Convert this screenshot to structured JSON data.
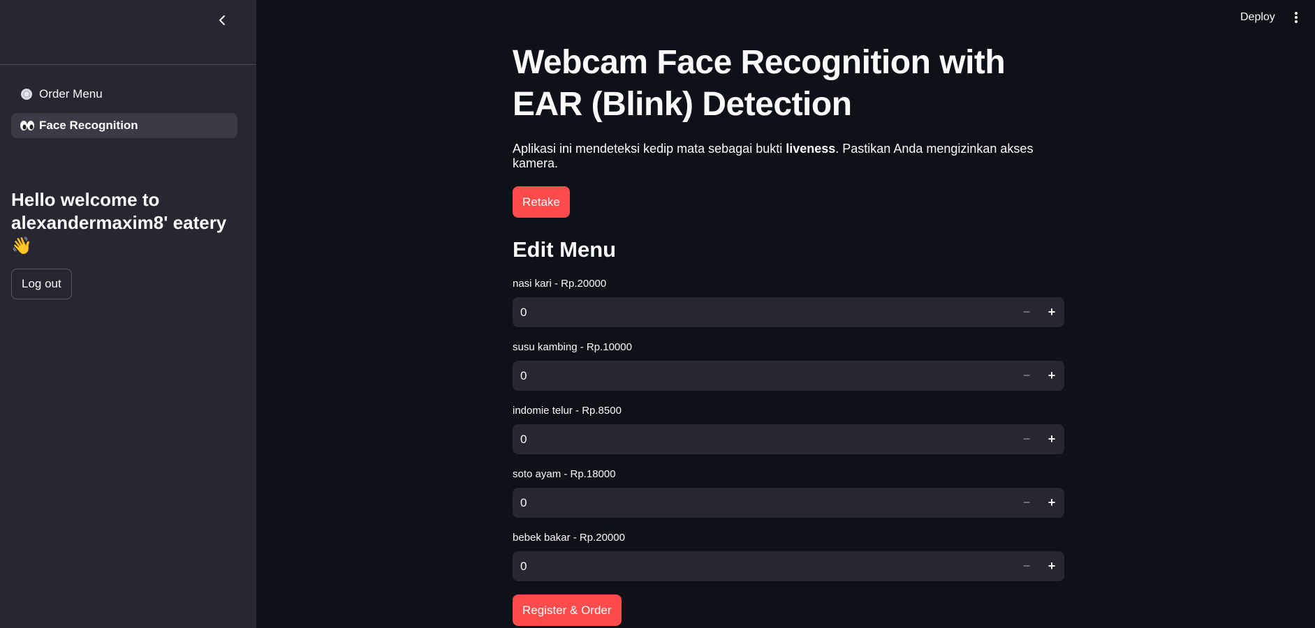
{
  "header": {
    "deploy_label": "Deploy"
  },
  "sidebar": {
    "items": [
      {
        "label": "Order Menu",
        "icon": "plate-icon",
        "active": false
      },
      {
        "label": "Face Recognition",
        "icon": "eyes-icon",
        "active": true
      }
    ],
    "welcome_text": "Hello welcome to alexandermaxim8' eatery",
    "welcome_emoji": "👋",
    "logout_label": "Log out"
  },
  "main": {
    "title": "Webcam Face Recognition with EAR (Blink) Detection",
    "description_before": "Aplikasi ini mendeteksi kedip mata sebagai bukti ",
    "description_bold": "liveness",
    "description_after": ". Pastikan Anda mengizinkan akses kamera.",
    "retake_label": "Retake",
    "section_title": "Edit Menu",
    "menu_items": [
      {
        "label": "nasi kari - Rp.20000",
        "value": "0"
      },
      {
        "label": "susu kambing - Rp.10000",
        "value": "0"
      },
      {
        "label": "indomie telur - Rp.8500",
        "value": "0"
      },
      {
        "label": "soto ayam - Rp.18000",
        "value": "0"
      },
      {
        "label": "bebek bakar - Rp.20000",
        "value": "0"
      }
    ],
    "register_label": "Register & Order"
  },
  "colors": {
    "accent": "#ff4b4b",
    "background": "#0e1117",
    "sidebar": "#262730"
  }
}
